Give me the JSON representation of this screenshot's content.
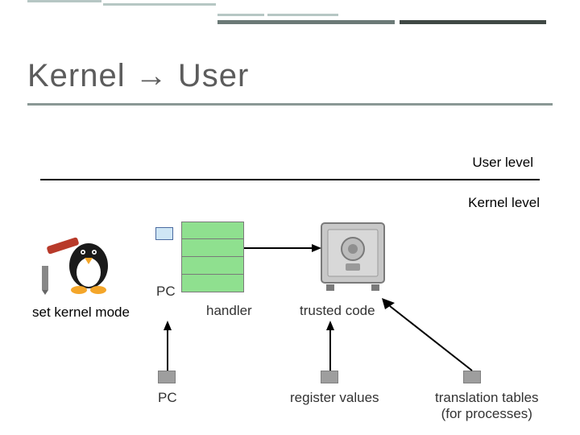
{
  "title": "Kernel → User",
  "labels": {
    "user_level": "User level",
    "kernel_level": "Kernel level",
    "set_kernel_mode": "set kernel mode",
    "pc_upper": "PC",
    "handler": "handler",
    "trusted_code": "trusted code",
    "pc_lower": "PC",
    "register_values": "register values",
    "translation_tables": "translation tables\n(for processes)"
  },
  "icons": {
    "tux": "tux-penguin-with-jackhammer",
    "safe": "safe-vault"
  },
  "stack_box_count": 4,
  "colors": {
    "stack_fill": "#8fe08f",
    "pc_fill": "#cfe6f5",
    "divider": "#000000",
    "title": "#5c5c5c"
  }
}
